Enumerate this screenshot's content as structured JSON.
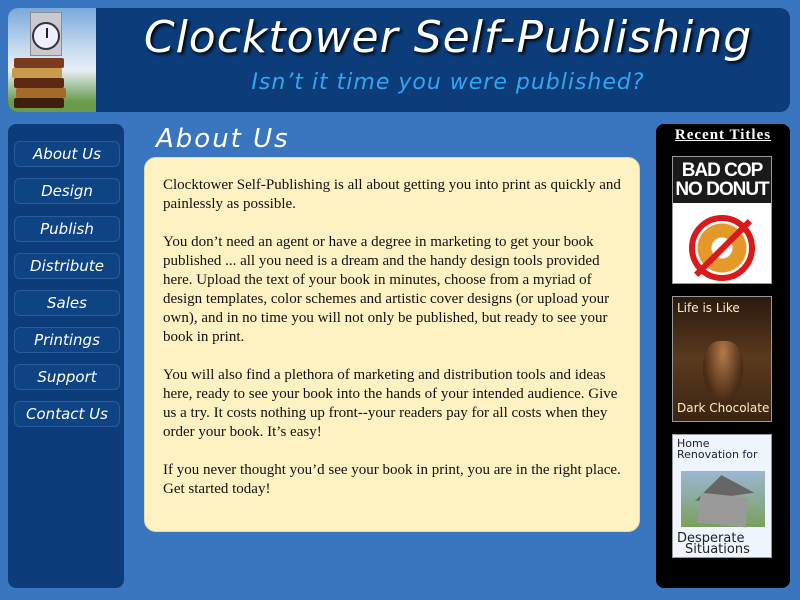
{
  "header": {
    "title": "Clocktower Self-Publishing",
    "tagline": "Isn’t it time you were published?"
  },
  "nav": {
    "items": [
      {
        "label": "About Us"
      },
      {
        "label": "Design"
      },
      {
        "label": "Publish"
      },
      {
        "label": "Distribute"
      },
      {
        "label": "Sales"
      },
      {
        "label": "Printings"
      },
      {
        "label": "Support"
      },
      {
        "label": "Contact Us"
      }
    ]
  },
  "main": {
    "section_title": "About Us",
    "paragraphs": [
      "Clocktower Self-Publishing is all about getting you into print as quickly and painlessly as possible.",
      "You don’t need an agent or have a degree in marketing to get your book published ... all you need is a dream and the handy design tools provided here. Upload the text of your book in minutes, choose from a myriad of design templates, color schemes and artistic cover designs (or upload your own), and in no time you will not only be published, but ready to see your book in print.",
      "You will also find a plethora of marketing and distribution tools and ideas here, ready to see your book into the hands of your intended audience. Give us a try. It costs nothing up front--your readers pay for all costs when they order your book. It’s easy!",
      "If you never thought you’d see your book in print, you are in the right place. Get started today!"
    ]
  },
  "sidebar": {
    "title": "Recent Titles",
    "covers": [
      {
        "line1": "BAD COP",
        "line2": "NO DONUT"
      },
      {
        "top": "Life is Like",
        "bottom": "Dark Chocolate"
      },
      {
        "top1": "Home",
        "top2": "Renovation for",
        "bottom1": "Desperate",
        "bottom2": "Situations"
      }
    ]
  },
  "colors": {
    "background": "#3a76c0",
    "panel": "#0c3d7a",
    "content_bg": "#fff2c2",
    "tagline": "#33a6f2"
  }
}
